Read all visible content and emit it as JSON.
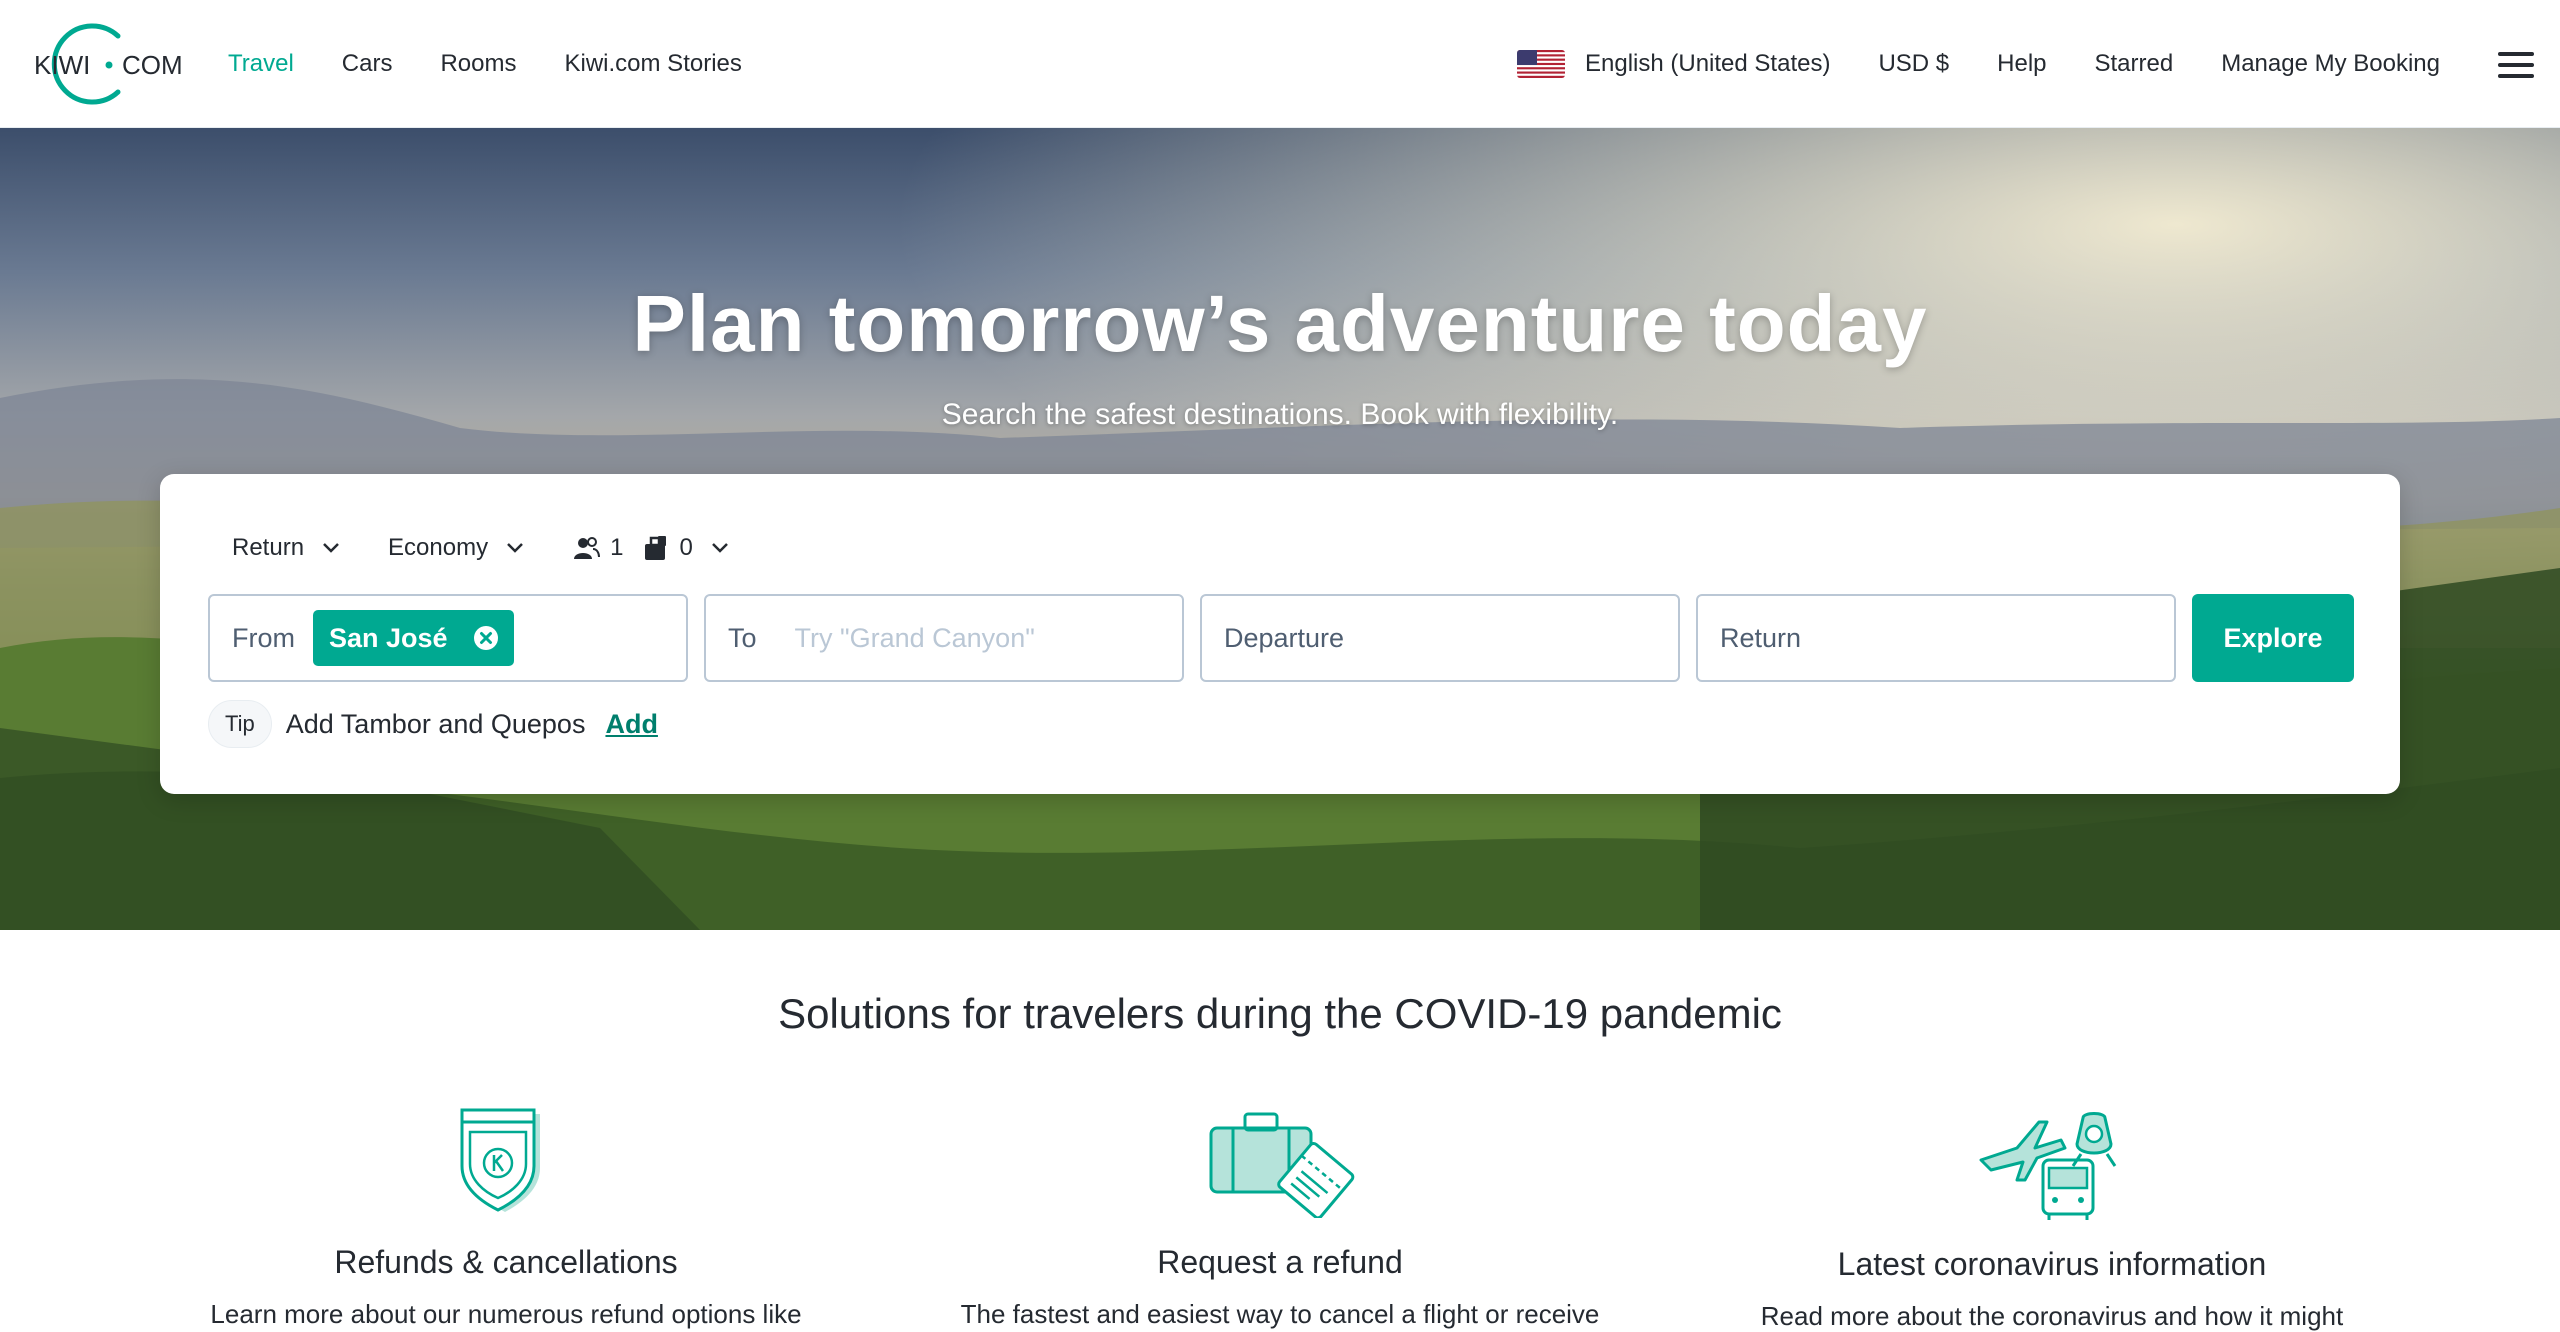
{
  "header": {
    "logo_text_left": "KIWI",
    "logo_text_right": "COM",
    "nav": [
      {
        "label": "Travel",
        "active": true
      },
      {
        "label": "Cars",
        "active": false
      },
      {
        "label": "Rooms",
        "active": false
      },
      {
        "label": "Kiwi.com Stories",
        "active": false
      }
    ],
    "language": "English (United States)",
    "currency": "USD $",
    "help": "Help",
    "starred": "Starred",
    "manage_booking": "Manage My Booking",
    "menu_icon": "hamburger-icon"
  },
  "hero": {
    "title": "Plan tomorrow’s adventure today",
    "subtitle": "Search the safest destinations. Book with flexibility."
  },
  "search": {
    "trip_type": "Return",
    "cabin_class": "Economy",
    "passengers": "1",
    "bags": "0",
    "from_label": "From",
    "from_value": "San José",
    "to_label": "To",
    "to_placeholder": "Try \"Grand Canyon\"",
    "departure_placeholder": "Departure",
    "return_placeholder": "Return",
    "explore_label": "Explore",
    "tip_badge": "Tip",
    "tip_text": "Add Tambor and Quepos",
    "tip_action": "Add"
  },
  "covid": {
    "title": "Solutions for travelers during the COVID-19 pandemic",
    "features": [
      {
        "title": "Refunds & cancellations",
        "text": "Learn more about our numerous refund options like",
        "icon": "shield-icon"
      },
      {
        "title": "Request a refund",
        "text": "The fastest and easiest way to cancel a flight or receive",
        "icon": "luggage-ticket-icon"
      },
      {
        "title": "Latest coronavirus information",
        "text": "Read more about the coronavirus and how it might",
        "icon": "transport-icon"
      }
    ]
  },
  "colors": {
    "brand": "#00a991",
    "brand_dark": "#007f6d",
    "text": "#252a31",
    "border": "#bac7d5"
  }
}
